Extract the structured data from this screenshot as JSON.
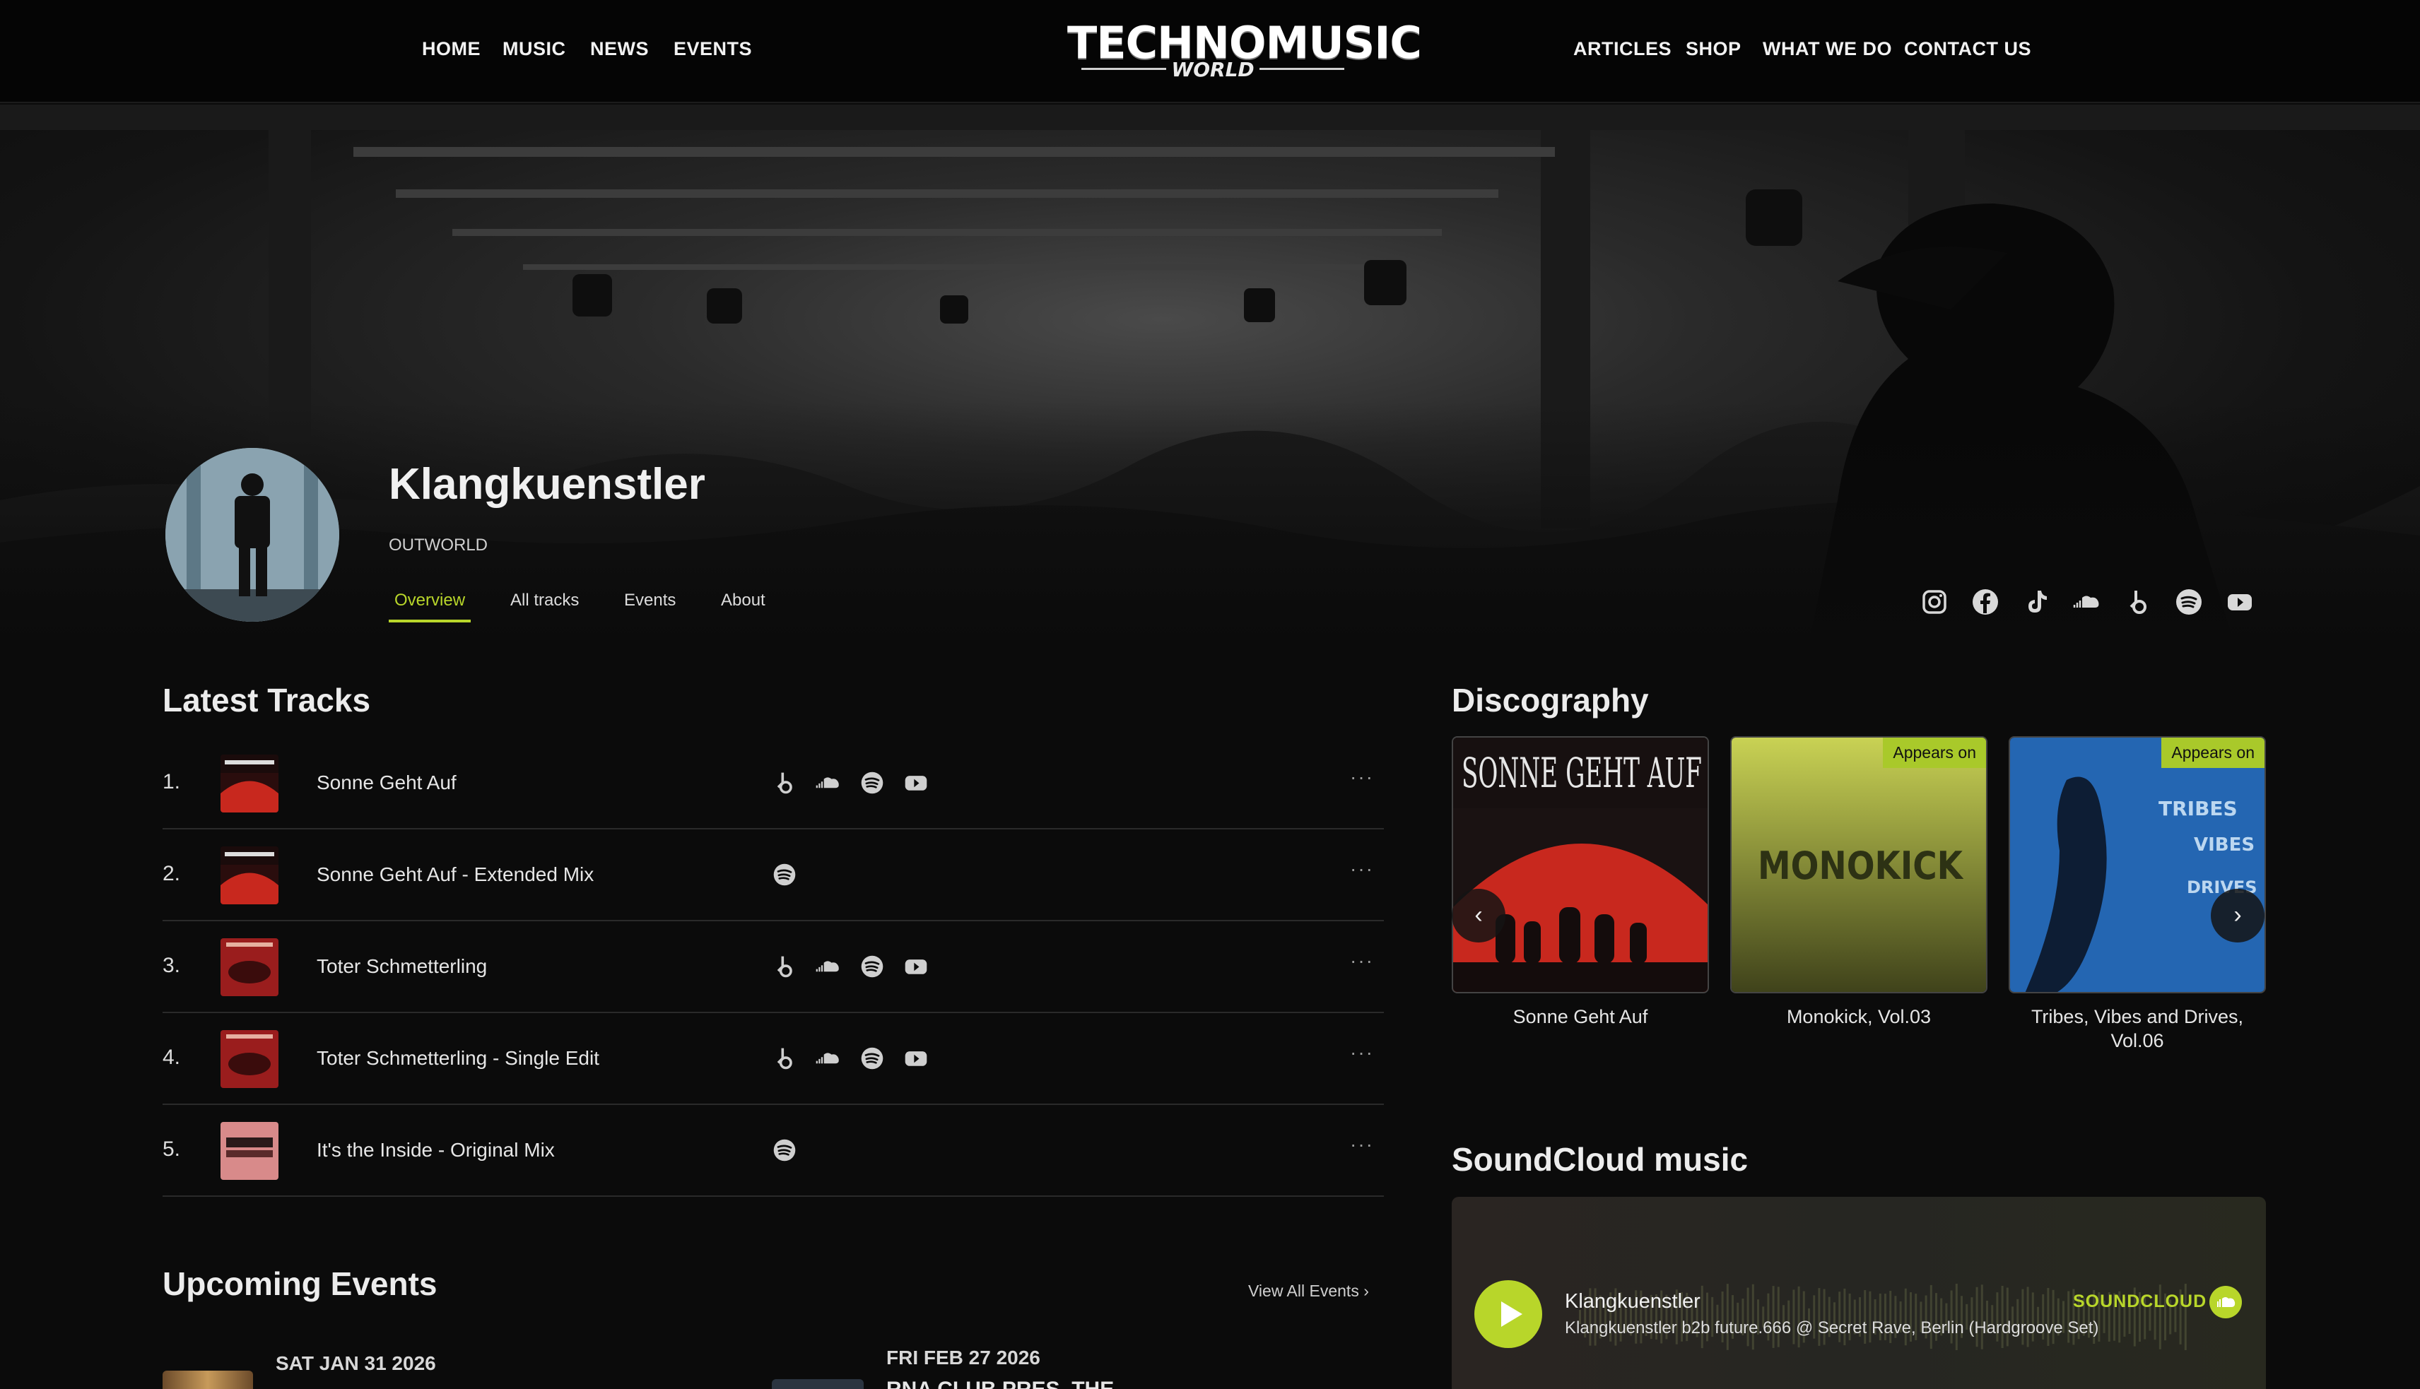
{
  "nav": {
    "left": [
      "HOME",
      "MUSIC",
      "NEWS",
      "EVENTS"
    ],
    "right": [
      "ARTICLES",
      "SHOP",
      "WHAT WE DO",
      "CONTACT US"
    ],
    "logo_main": "TECHNOMUSIC",
    "logo_sub": "WORLD"
  },
  "artist": {
    "name": "Klangkuenstler",
    "label": "OUTWORLD"
  },
  "tabs": [
    "Overview",
    "All tracks",
    "Events",
    "About"
  ],
  "social_icons": [
    "instagram-icon",
    "facebook-icon",
    "tiktok-icon",
    "soundcloud-icon",
    "beatport-icon",
    "spotify-icon",
    "youtube-icon"
  ],
  "latest_tracks": {
    "title": "Latest Tracks",
    "items": [
      {
        "num": "1.",
        "title": "Sonne Geht Auf",
        "platforms": [
          "beatport",
          "soundcloud",
          "spotify",
          "youtube"
        ]
      },
      {
        "num": "2.",
        "title": "Sonne Geht Auf - Extended Mix",
        "platforms": [
          "spotify"
        ]
      },
      {
        "num": "3.",
        "title": "Toter Schmetterling",
        "platforms": [
          "beatport",
          "soundcloud",
          "spotify",
          "youtube"
        ]
      },
      {
        "num": "4.",
        "title": "Toter Schmetterling - Single Edit",
        "platforms": [
          "beatport",
          "soundcloud",
          "spotify",
          "youtube"
        ]
      },
      {
        "num": "5.",
        "title": "It's the Inside - Original Mix",
        "platforms": [
          "spotify"
        ]
      }
    ]
  },
  "discography": {
    "title": "Discography",
    "items": [
      {
        "title": "Sonne Geht Auf",
        "badge": ""
      },
      {
        "title": "Monokick, Vol.03",
        "badge": "Appears on"
      },
      {
        "title": "Tribes, Vibes and Drives, Vol.06",
        "badge": "Appears on"
      }
    ]
  },
  "upcoming": {
    "title": "Upcoming Events",
    "view_all": "View All Events ›",
    "events": [
      {
        "date": "SAT JAN 31 2026"
      },
      {
        "date": "FRI FEB 27 2026",
        "title": "RNA CLUB PRES. THE"
      }
    ]
  },
  "soundcloud": {
    "title": "SoundCloud music",
    "artist": "Klangkuenstler",
    "track": "Klangkuenstler b2b future.666 @ Secret Rave, Berlin (Hardgroove Set)",
    "brand": "SOUNDCLOUD"
  },
  "colors": {
    "accent": "#b8d62a",
    "background": "#0b0b0b"
  }
}
